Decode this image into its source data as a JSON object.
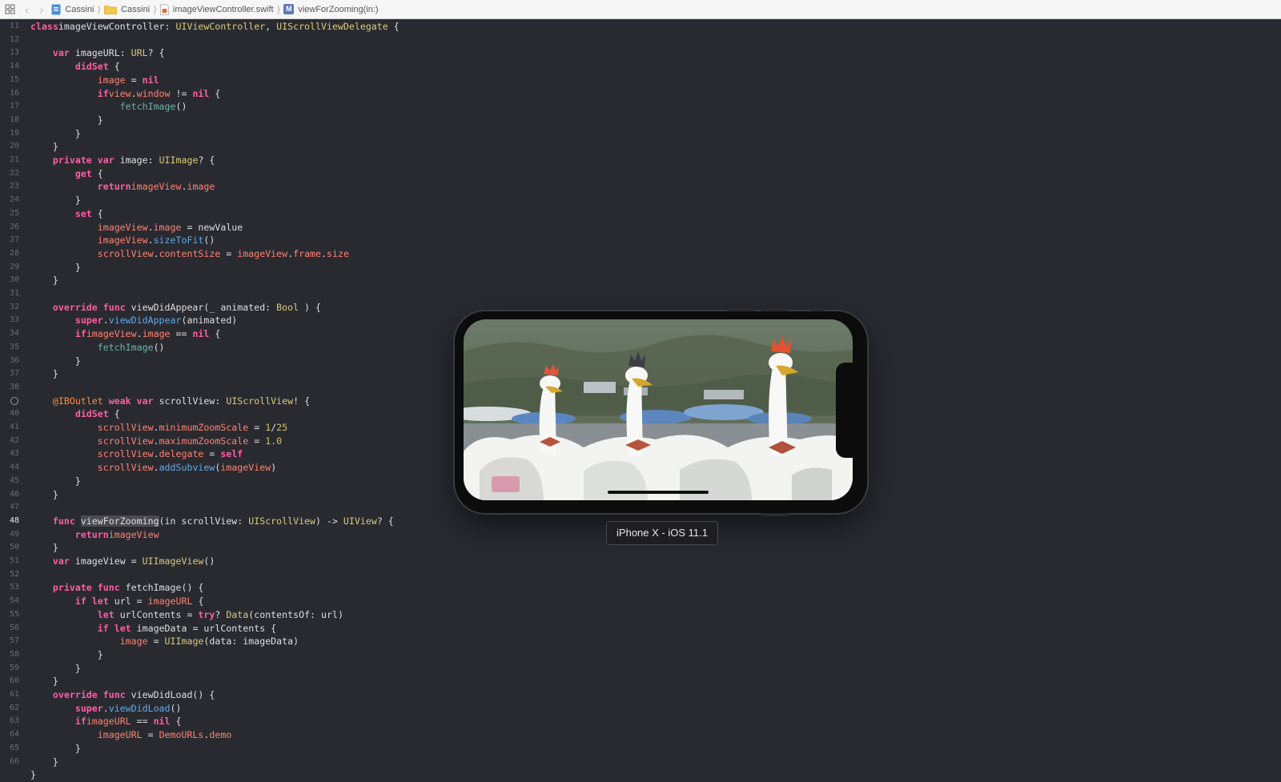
{
  "jump_bar": {
    "items": [
      "Cassini",
      "Cassini",
      "imageViewController.swift",
      "viewForZooming(in:)"
    ]
  },
  "editor": {
    "current_line": 48,
    "lines": [
      {
        "n": "11",
        "parts": [
          [
            "kw",
            "class"
          ],
          [
            "",
            "imageViewController: "
          ],
          [
            "ty",
            "UIViewController"
          ],
          [
            "",
            ", "
          ],
          [
            "ty",
            "UIScrollViewDelegate"
          ],
          [
            "",
            " {"
          ]
        ]
      },
      {
        "n": "12",
        "parts": []
      },
      {
        "n": "13",
        "parts": [
          [
            "",
            "    "
          ],
          [
            "kw",
            "var"
          ],
          [
            "",
            " imageURL: "
          ],
          [
            "ty",
            "URL"
          ],
          [
            "",
            "? {"
          ]
        ]
      },
      {
        "n": "14",
        "parts": [
          [
            "",
            "        "
          ],
          [
            "kw",
            "didSet"
          ],
          [
            "",
            " {"
          ]
        ]
      },
      {
        "n": "15",
        "parts": [
          [
            "",
            "            "
          ],
          [
            "pr",
            "image"
          ],
          [
            "",
            " = "
          ],
          [
            "kw",
            "nil"
          ]
        ]
      },
      {
        "n": "16",
        "parts": [
          [
            "",
            "            "
          ],
          [
            "kw",
            "if"
          ],
          [
            " ",
            ""
          ],
          [
            "pr",
            "view"
          ],
          [
            "",
            "."
          ],
          [
            "pr",
            "window"
          ],
          [
            "",
            " != "
          ],
          [
            "kw",
            "nil"
          ],
          [
            "",
            " {"
          ]
        ]
      },
      {
        "n": "17",
        "parts": [
          [
            "",
            "                "
          ],
          [
            "fn",
            "fetchImage"
          ],
          [
            "",
            "()"
          ]
        ]
      },
      {
        "n": "18",
        "parts": [
          [
            "",
            "            }"
          ]
        ]
      },
      {
        "n": "19",
        "parts": [
          [
            "",
            "        }"
          ]
        ]
      },
      {
        "n": "20",
        "parts": [
          [
            "",
            "    }"
          ]
        ]
      },
      {
        "n": "21",
        "parts": [
          [
            "",
            "    "
          ],
          [
            "kw",
            "private"
          ],
          [
            "",
            " "
          ],
          [
            "kw",
            "var"
          ],
          [
            "",
            " image: "
          ],
          [
            "ty",
            "UIImage"
          ],
          [
            "",
            "? {"
          ]
        ]
      },
      {
        "n": "22",
        "parts": [
          [
            "",
            "        "
          ],
          [
            "kw",
            "get"
          ],
          [
            "",
            " {"
          ]
        ]
      },
      {
        "n": "23",
        "parts": [
          [
            "",
            "            "
          ],
          [
            "kw",
            "return"
          ],
          [
            " ",
            ""
          ],
          [
            "pr",
            "imageView"
          ],
          [
            "",
            "."
          ],
          [
            "pr",
            "image"
          ]
        ]
      },
      {
        "n": "24",
        "parts": [
          [
            "",
            "        }"
          ]
        ]
      },
      {
        "n": "25",
        "parts": [
          [
            "",
            "        "
          ],
          [
            "kw",
            "set"
          ],
          [
            "",
            " {"
          ]
        ]
      },
      {
        "n": "26",
        "parts": [
          [
            "",
            "            "
          ],
          [
            "pr",
            "imageView"
          ],
          [
            "",
            "."
          ],
          [
            "pr",
            "image"
          ],
          [
            "",
            " = newValue"
          ]
        ]
      },
      {
        "n": "27",
        "parts": [
          [
            "",
            "            "
          ],
          [
            "pr",
            "imageView"
          ],
          [
            "",
            "."
          ],
          [
            "lib",
            "sizeToFit"
          ],
          [
            "",
            "()"
          ]
        ]
      },
      {
        "n": "28",
        "parts": [
          [
            "",
            "            "
          ],
          [
            "pr",
            "scrollView"
          ],
          [
            "",
            "."
          ],
          [
            "pr",
            "contentSize"
          ],
          [
            "",
            " = "
          ],
          [
            "pr",
            "imageView"
          ],
          [
            "",
            "."
          ],
          [
            "pr",
            "frame"
          ],
          [
            "",
            "."
          ],
          [
            "pr",
            "size"
          ]
        ]
      },
      {
        "n": "29",
        "parts": [
          [
            "",
            "        }"
          ]
        ]
      },
      {
        "n": "30",
        "parts": [
          [
            "",
            "    }"
          ]
        ]
      },
      {
        "n": "31",
        "parts": []
      },
      {
        "n": "32",
        "parts": [
          [
            "",
            "    "
          ],
          [
            "kw",
            "override"
          ],
          [
            "",
            " "
          ],
          [
            "kw",
            "func"
          ],
          [
            "",
            " viewDidAppear(_ animated: "
          ],
          [
            "ty",
            "Bool"
          ],
          [
            "",
            " ) {"
          ]
        ]
      },
      {
        "n": "33",
        "parts": [
          [
            "",
            "        "
          ],
          [
            "kw",
            "super"
          ],
          [
            "",
            "."
          ],
          [
            "lib",
            "viewDidAppear"
          ],
          [
            "",
            "(animated)"
          ]
        ]
      },
      {
        "n": "34",
        "parts": [
          [
            "",
            "        "
          ],
          [
            "kw",
            "if"
          ],
          [
            " ",
            ""
          ],
          [
            "pr",
            "imageView"
          ],
          [
            "",
            "."
          ],
          [
            "pr",
            "image"
          ],
          [
            "",
            " == "
          ],
          [
            "kw",
            "nil"
          ],
          [
            "",
            " {"
          ]
        ]
      },
      {
        "n": "35",
        "parts": [
          [
            "",
            "            "
          ],
          [
            "fn",
            "fetchImage"
          ],
          [
            "",
            "()"
          ]
        ]
      },
      {
        "n": "36",
        "parts": [
          [
            "",
            "        }"
          ]
        ]
      },
      {
        "n": "37",
        "parts": [
          [
            "",
            "    }"
          ]
        ]
      },
      {
        "n": "38",
        "parts": []
      },
      {
        "n": "",
        "parts": [
          [
            "",
            "    "
          ],
          [
            "dec",
            "@IBOutlet"
          ],
          [
            "",
            " "
          ],
          [
            "kw",
            "weak"
          ],
          [
            "",
            " "
          ],
          [
            "kw",
            "var"
          ],
          [
            "",
            " scrollView: "
          ],
          [
            "ty",
            "UIScrollView"
          ],
          [
            "",
            "! {"
          ]
        ]
      },
      {
        "n": "40",
        "parts": [
          [
            "",
            "        "
          ],
          [
            "kw",
            "didSet"
          ],
          [
            "",
            " {"
          ]
        ]
      },
      {
        "n": "41",
        "parts": [
          [
            "",
            "            "
          ],
          [
            "pr",
            "scrollView"
          ],
          [
            "",
            "."
          ],
          [
            "pr",
            "minimumZoomScale"
          ],
          [
            "",
            " = "
          ],
          [
            "num",
            "1"
          ],
          [
            "",
            "/"
          ],
          [
            "num",
            "25"
          ]
        ]
      },
      {
        "n": "42",
        "parts": [
          [
            "",
            "            "
          ],
          [
            "pr",
            "scrollView"
          ],
          [
            "",
            "."
          ],
          [
            "pr",
            "maximumZoomScale"
          ],
          [
            "",
            " = "
          ],
          [
            "num",
            "1.0"
          ]
        ]
      },
      {
        "n": "43",
        "parts": [
          [
            "",
            "            "
          ],
          [
            "pr",
            "scrollView"
          ],
          [
            "",
            "."
          ],
          [
            "pr",
            "delegate"
          ],
          [
            "",
            " = "
          ],
          [
            "kw",
            "self"
          ]
        ]
      },
      {
        "n": "44",
        "parts": [
          [
            "",
            "            "
          ],
          [
            "pr",
            "scrollView"
          ],
          [
            "",
            "."
          ],
          [
            "lib",
            "addSubview"
          ],
          [
            "",
            "("
          ],
          [
            "pr",
            "imageView"
          ],
          [
            "",
            ")"
          ]
        ]
      },
      {
        "n": "45",
        "parts": [
          [
            "",
            "        }"
          ]
        ]
      },
      {
        "n": "46",
        "parts": [
          [
            "",
            "    }"
          ]
        ]
      },
      {
        "n": "47",
        "parts": []
      },
      {
        "n": "48",
        "parts": [
          [
            "",
            "    "
          ],
          [
            "kw",
            "func"
          ],
          [
            "",
            " "
          ],
          [
            "hl",
            "viewForZooming"
          ],
          [
            "",
            "(in scrollView: "
          ],
          [
            "ty",
            "UIScrollView"
          ],
          [
            "",
            ") -> "
          ],
          [
            "ty",
            "UIView"
          ],
          [
            "",
            "? {"
          ]
        ]
      },
      {
        "n": "49",
        "parts": [
          [
            "",
            "        "
          ],
          [
            "kw",
            "return"
          ],
          [
            " ",
            ""
          ],
          [
            "pr",
            "imageView"
          ]
        ]
      },
      {
        "n": "50",
        "parts": [
          [
            "",
            "    }"
          ]
        ]
      },
      {
        "n": "51",
        "parts": [
          [
            "",
            "    "
          ],
          [
            "kw",
            "var"
          ],
          [
            "",
            " imageView = "
          ],
          [
            "ty",
            "UIImageView"
          ],
          [
            "",
            "()"
          ]
        ]
      },
      {
        "n": "52",
        "parts": []
      },
      {
        "n": "53",
        "parts": [
          [
            "",
            "    "
          ],
          [
            "kw",
            "private"
          ],
          [
            "",
            " "
          ],
          [
            "kw",
            "func"
          ],
          [
            "",
            " fetchImage() {"
          ]
        ]
      },
      {
        "n": "54",
        "parts": [
          [
            "",
            "        "
          ],
          [
            "kw",
            "if"
          ],
          [
            "",
            " "
          ],
          [
            "kw",
            "let"
          ],
          [
            "",
            " url = "
          ],
          [
            "pr",
            "imageURL"
          ],
          [
            "",
            " {"
          ]
        ]
      },
      {
        "n": "55",
        "parts": [
          [
            "",
            "            "
          ],
          [
            "kw",
            "let"
          ],
          [
            "",
            " urlContents = "
          ],
          [
            "kw",
            "try"
          ],
          [
            "",
            "? "
          ],
          [
            "ty",
            "Data"
          ],
          [
            "",
            "(contentsOf: url)"
          ]
        ]
      },
      {
        "n": "56",
        "parts": [
          [
            "",
            "            "
          ],
          [
            "kw",
            "if"
          ],
          [
            "",
            " "
          ],
          [
            "kw",
            "let"
          ],
          [
            "",
            " imageData = urlContents {"
          ]
        ]
      },
      {
        "n": "57",
        "parts": [
          [
            "",
            "                "
          ],
          [
            "pr",
            "image"
          ],
          [
            "",
            " = "
          ],
          [
            "ty",
            "UIImage"
          ],
          [
            "",
            "(data: imageData)"
          ]
        ]
      },
      {
        "n": "58",
        "parts": [
          [
            "",
            "            }"
          ]
        ]
      },
      {
        "n": "59",
        "parts": [
          [
            "",
            "        }"
          ]
        ]
      },
      {
        "n": "60",
        "parts": [
          [
            "",
            "    }"
          ]
        ]
      },
      {
        "n": "61",
        "parts": [
          [
            "",
            "    "
          ],
          [
            "kw",
            "override"
          ],
          [
            "",
            " "
          ],
          [
            "kw",
            "func"
          ],
          [
            "",
            " viewDidLoad() {"
          ]
        ]
      },
      {
        "n": "62",
        "parts": [
          [
            "",
            "        "
          ],
          [
            "kw",
            "super"
          ],
          [
            "",
            "."
          ],
          [
            "lib",
            "viewDidLoad"
          ],
          [
            "",
            "()"
          ]
        ]
      },
      {
        "n": "63",
        "parts": [
          [
            "",
            "        "
          ],
          [
            "kw",
            "if"
          ],
          [
            " ",
            ""
          ],
          [
            "pr",
            "imageURL"
          ],
          [
            "",
            " == "
          ],
          [
            "kw",
            "nil"
          ],
          [
            "",
            " {"
          ]
        ]
      },
      {
        "n": "64",
        "parts": [
          [
            "",
            "            "
          ],
          [
            "pr",
            "imageURL"
          ],
          [
            "",
            " = "
          ],
          [
            "pr",
            "DemoURLs"
          ],
          [
            "",
            "."
          ],
          [
            "pr",
            "demo"
          ]
        ]
      },
      {
        "n": "65",
        "parts": [
          [
            "",
            "        }"
          ]
        ]
      },
      {
        "n": "66",
        "parts": [
          [
            "",
            "    }"
          ]
        ]
      },
      {
        "n": "",
        "parts": [
          [
            "",
            "}"
          ]
        ]
      }
    ]
  },
  "simulator": {
    "label": "iPhone X - iOS 11.1"
  }
}
